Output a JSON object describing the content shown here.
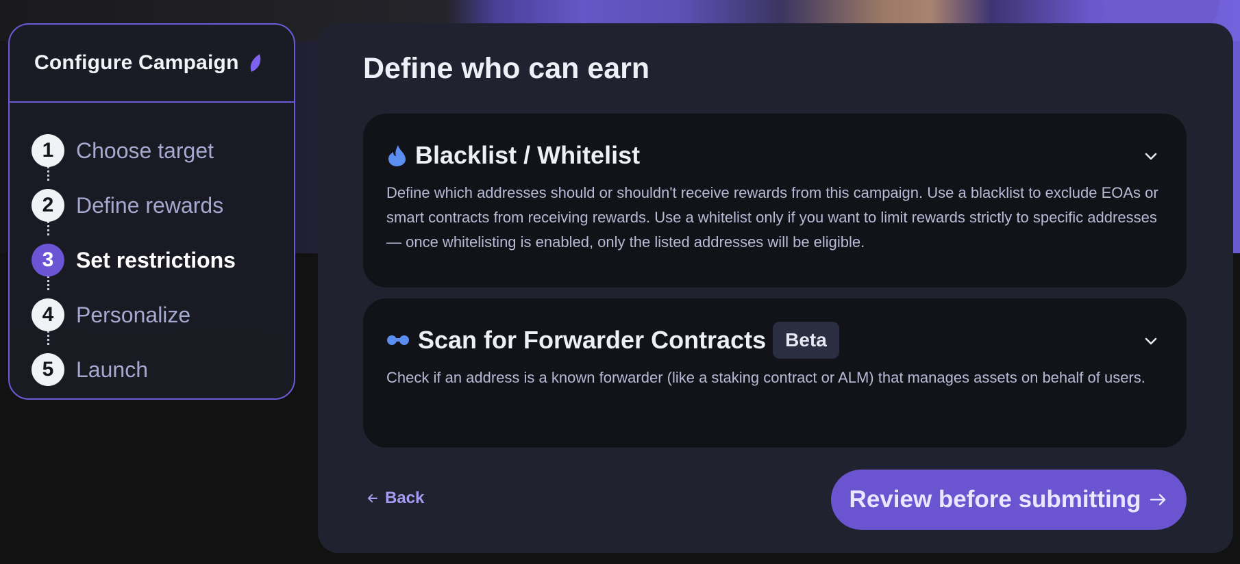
{
  "sidebar": {
    "title": "Configure Campaign",
    "steps": [
      {
        "number": "1",
        "label": "Choose target",
        "state": "default"
      },
      {
        "number": "2",
        "label": "Define rewards",
        "state": "default"
      },
      {
        "number": "3",
        "label": "Set restrictions",
        "state": "active"
      },
      {
        "number": "4",
        "label": "Personalize",
        "state": "default"
      },
      {
        "number": "5",
        "label": "Launch",
        "state": "default"
      }
    ]
  },
  "main": {
    "title": "Define who can earn",
    "sections": [
      {
        "icon": "droplet-icon",
        "title": "Blacklist / Whitelist",
        "description": "Define which addresses should or shouldn't receive rewards from this campaign. Use a blacklist to exclude EOAs or smart contracts from receiving rewards. Use a whitelist only if you want to limit rewards strictly to specific addresses — once whitelisting is enabled, only the listed addresses will be eligible."
      },
      {
        "icon": "binoculars-icon",
        "title": "Scan for Forwarder Contracts",
        "badge": "Beta",
        "description": "Check if an address is a known forwarder (like a staking contract or ALM) that manages assets on behalf of users."
      }
    ],
    "back_label": "Back",
    "submit_label": "Review before submitting"
  },
  "colors": {
    "accent": "#6a54d0",
    "panel": "#20222f",
    "card": "#111319",
    "icon_blue": "#5b8ef0"
  }
}
